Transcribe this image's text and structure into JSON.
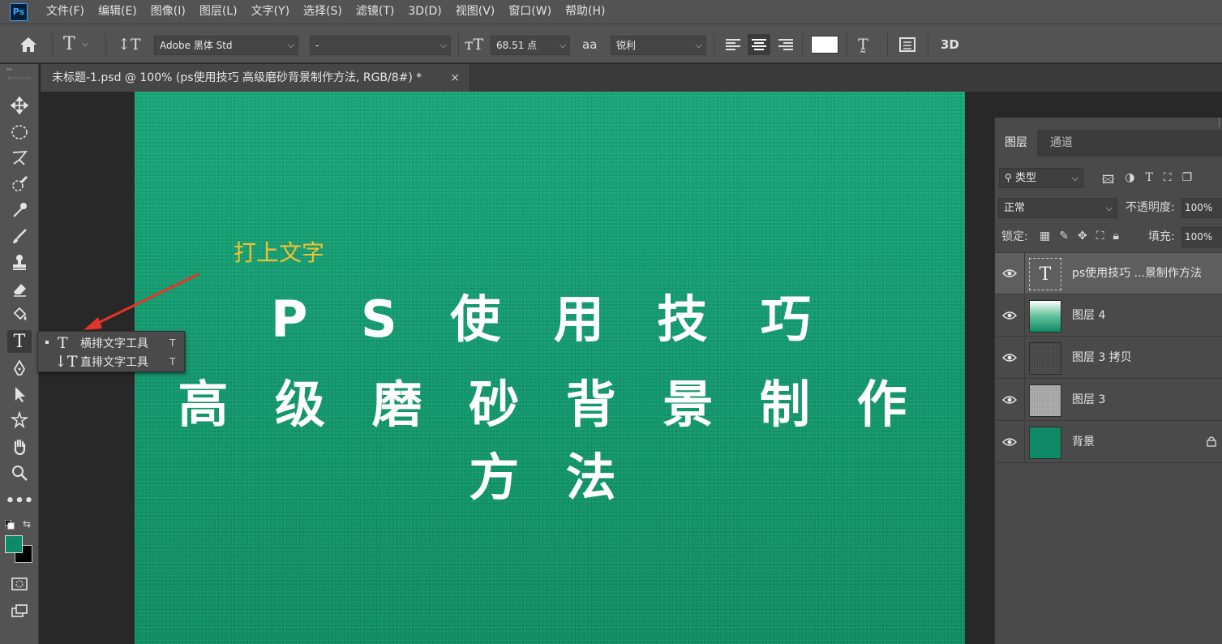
{
  "app": {
    "logo": "Ps"
  },
  "menu": [
    "文件(F)",
    "编辑(E)",
    "图像(I)",
    "图层(L)",
    "文字(Y)",
    "选择(S)",
    "滤镜(T)",
    "3D(D)",
    "视图(V)",
    "窗口(W)",
    "帮助(H)"
  ],
  "options": {
    "font_family": "Adobe 黑体 Std",
    "font_style": "-",
    "font_size": "68.51 点",
    "aa_icon_text": "aa",
    "antialias": "锐利",
    "threed_label": "3D"
  },
  "document_tab": {
    "title": "未标题-1.psd @ 100% (ps使用技巧 高级磨砂背景制作方法, RGB/8#) *",
    "close": "×"
  },
  "canvas": {
    "title_line1": "P S 使 用 技 巧",
    "title_line2": "高 级 磨 砂 背 景 制 作 方 法",
    "annotation": "打上文字"
  },
  "flyout": {
    "items": [
      {
        "icon": "T",
        "label": "横排文字工具",
        "shortcut": "T"
      },
      {
        "icon": "↓T",
        "label": "直排文字工具",
        "shortcut": "T"
      }
    ]
  },
  "layers_panel": {
    "tabs": [
      "图层",
      "通道"
    ],
    "filter_label": "类型",
    "blend_mode": "正常",
    "opacity_label": "不透明度:",
    "opacity_value": "100%",
    "lock_label": "锁定:",
    "fill_label": "填充:",
    "fill_value": "100%",
    "layers": [
      {
        "name": "ps使用技巧 ...景制作方法",
        "thumb_text": "T",
        "selected": true
      },
      {
        "name": "图层 4"
      },
      {
        "name": "图层 3 拷贝"
      },
      {
        "name": "图层 3"
      },
      {
        "name": "背景",
        "locked": true
      }
    ]
  },
  "colors": {
    "foreground": "#0f8a66",
    "background": "#000000",
    "accent": "#31a8ff",
    "annotation": "#f2c12e",
    "arrow": "#e8332a"
  }
}
